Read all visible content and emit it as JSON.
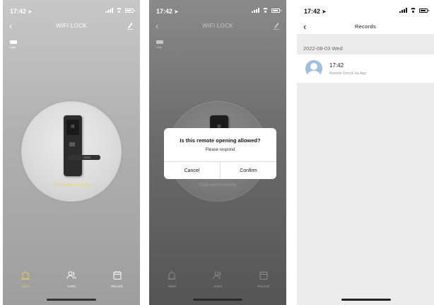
{
  "status_bar": {
    "time": "17:42",
    "location_arrow": "◂"
  },
  "screen1": {
    "title": "WIFI LOCK",
    "battery_label": "High",
    "click_open_text": "Click open remotely",
    "tabs": [
      {
        "label": "Alarm",
        "icon": "alarm-icon"
      },
      {
        "label": "Users",
        "icon": "users-icon"
      },
      {
        "label": "Records",
        "icon": "calendar-icon"
      }
    ]
  },
  "screen2": {
    "title": "WIFI LOCK",
    "battery_label": "High",
    "click_open_text": "Click open remotely",
    "dialog": {
      "question": "Is this remote opening allowed?",
      "message": "Please respond",
      "cancel": "Cancel",
      "confirm": "Confirm"
    },
    "tabs": [
      {
        "label": "Alarm"
      },
      {
        "label": "Users"
      },
      {
        "label": "Records"
      }
    ]
  },
  "screen3": {
    "title": "Records",
    "date_header": "2022-08-03 Wed",
    "records": [
      {
        "time": "17:42",
        "description": "Remote Unlock via App"
      }
    ]
  },
  "colors": {
    "accent_yellow": "#e0cc50",
    "avatar_blue": "#9cc0de"
  }
}
